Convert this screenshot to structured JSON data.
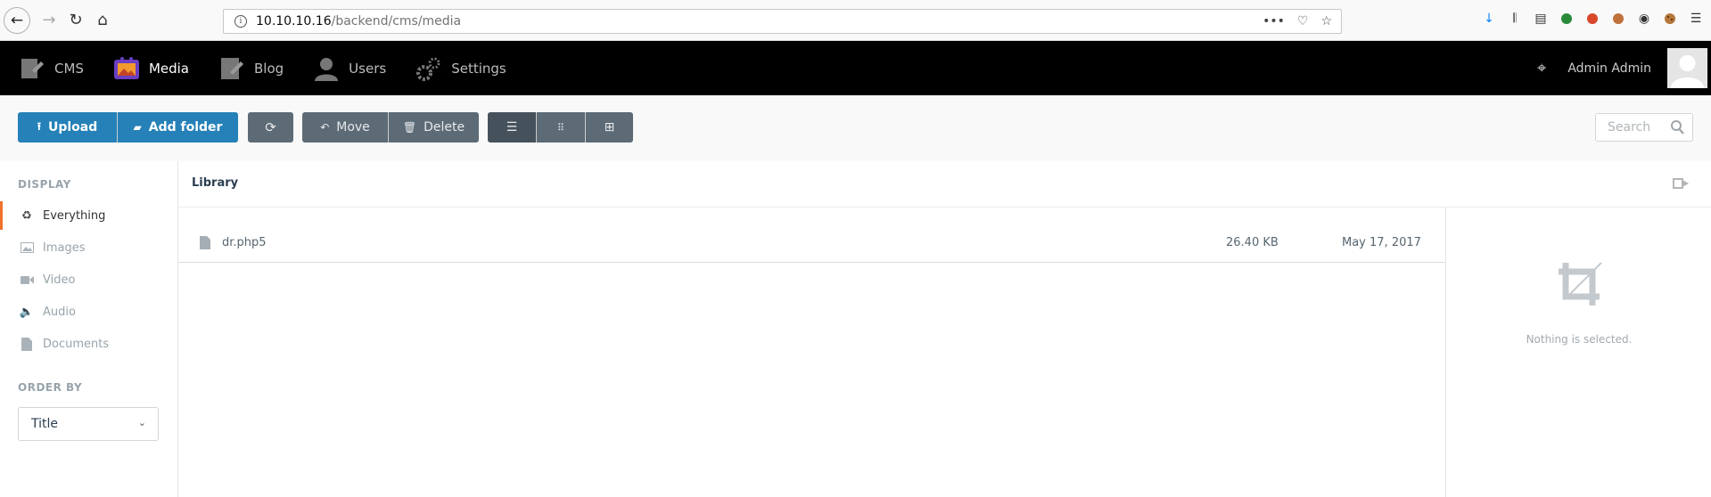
{
  "browser": {
    "url_host": "10.10.10.16",
    "url_path": "/backend/cms/media"
  },
  "header": {
    "nav": [
      {
        "label": "CMS"
      },
      {
        "label": "Media"
      },
      {
        "label": "Blog"
      },
      {
        "label": "Users"
      },
      {
        "label": "Settings"
      }
    ],
    "user_name": "Admin Admin"
  },
  "toolbar": {
    "upload_label": "Upload",
    "add_folder_label": "Add folder",
    "move_label": "Move",
    "delete_label": "Delete",
    "search_placeholder": "Search"
  },
  "sidebar": {
    "display_heading": "DISPLAY",
    "items": [
      {
        "label": "Everything"
      },
      {
        "label": "Images"
      },
      {
        "label": "Video"
      },
      {
        "label": "Audio"
      },
      {
        "label": "Documents"
      }
    ],
    "order_heading": "ORDER BY",
    "order_value": "Title"
  },
  "library": {
    "title": "Library",
    "files": [
      {
        "name": "dr.php5",
        "size": "26.40 KB",
        "date": "May 17, 2017"
      }
    ]
  },
  "details": {
    "empty_text": "Nothing is selected."
  },
  "colors": {
    "primary": "#2581b8",
    "active_indicator": "#f0722b",
    "header_bg": "#000000"
  }
}
